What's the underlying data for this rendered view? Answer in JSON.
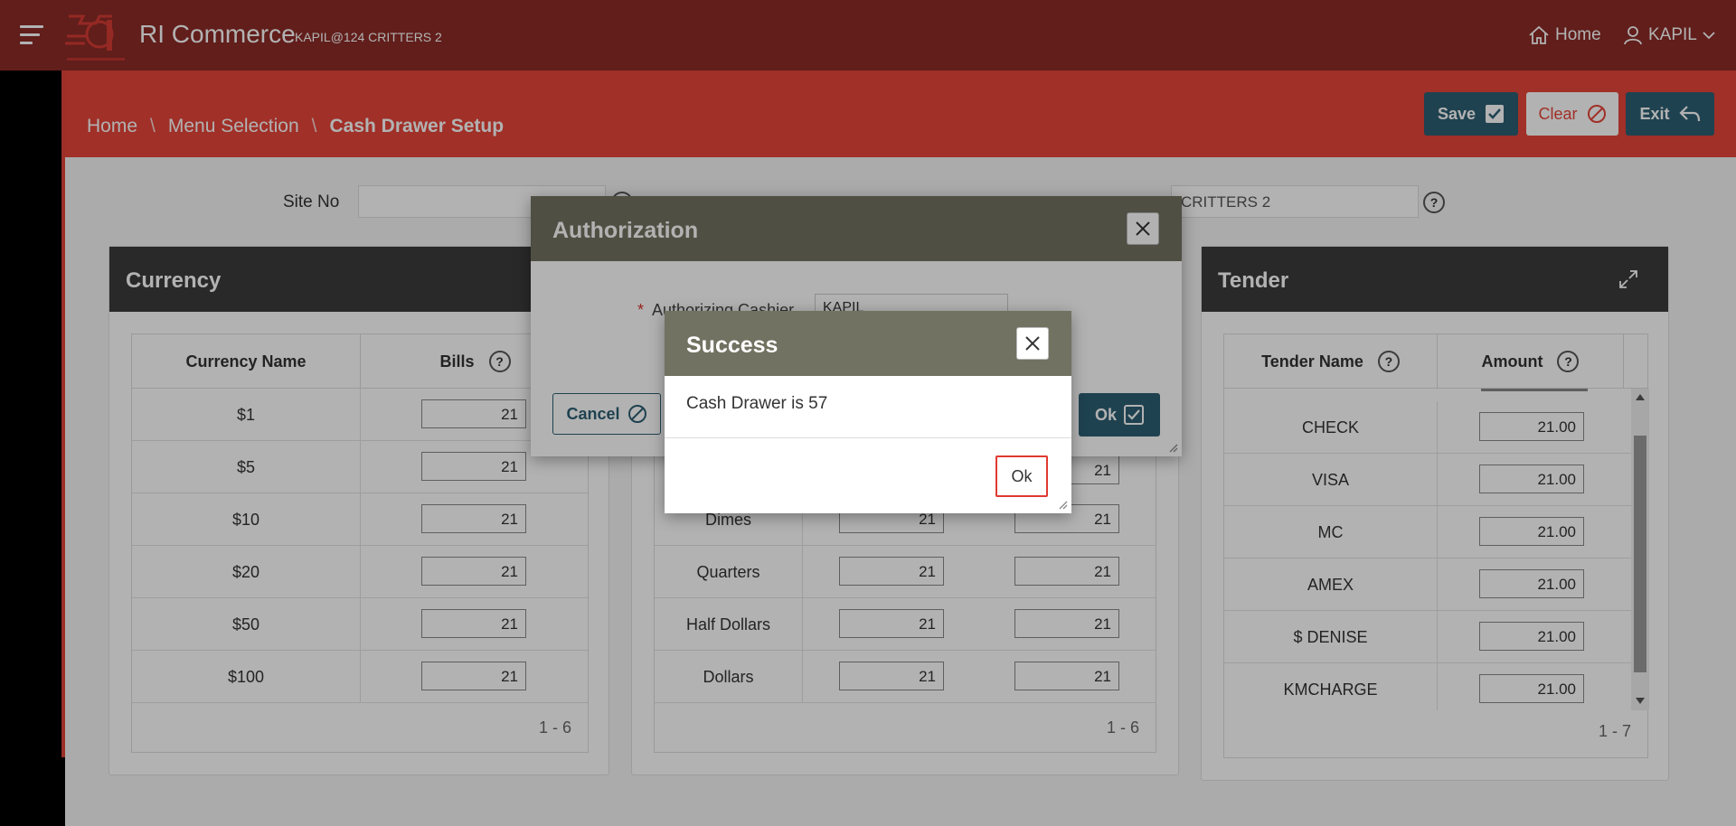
{
  "header": {
    "app_title": "RI Commerce",
    "app_subtitle": "KAPIL@124 CRITTERS 2",
    "home_label": "Home",
    "user_label": "KAPIL"
  },
  "breadcrumb": {
    "home": "Home",
    "menu": "Menu Selection",
    "current": "Cash Drawer Setup"
  },
  "toolbar": {
    "save_label": "Save",
    "clear_label": "Clear",
    "exit_label": "Exit"
  },
  "site": {
    "label": "Site No",
    "site_value": "",
    "location_value": "CRITTERS 2"
  },
  "currency_panel": {
    "title": "Currency",
    "col_name": "Currency Name",
    "col_bills": "Bills",
    "rows": [
      {
        "name": "$1",
        "bills": "21"
      },
      {
        "name": "$5",
        "bills": "21"
      },
      {
        "name": "$10",
        "bills": "21"
      },
      {
        "name": "$20",
        "bills": "21"
      },
      {
        "name": "$50",
        "bills": "21"
      },
      {
        "name": "$100",
        "bills": "21"
      }
    ],
    "pager": "1 - 6"
  },
  "coin_panel": {
    "rows": [
      {
        "name": "Dimes",
        "a": "21",
        "b": "21"
      },
      {
        "name": "Quarters",
        "a": "21",
        "b": "21"
      },
      {
        "name": "Half Dollars",
        "a": "21",
        "b": "21"
      },
      {
        "name": "Dollars",
        "a": "21",
        "b": "21"
      }
    ],
    "hidden_row_b": "21",
    "pager": "1 - 6"
  },
  "tender_panel": {
    "title": "Tender",
    "col_name": "Tender Name",
    "col_amount": "Amount",
    "rows": [
      {
        "name": "CHECK",
        "amount": "21.00"
      },
      {
        "name": "VISA",
        "amount": "21.00"
      },
      {
        "name": "MC",
        "amount": "21.00"
      },
      {
        "name": "AMEX",
        "amount": "21.00"
      },
      {
        "name": "$ DENISE",
        "amount": "21.00"
      },
      {
        "name": "KMCHARGE",
        "amount": "21.00"
      }
    ],
    "pager": "1 - 7"
  },
  "auth_dialog": {
    "title": "Authorization",
    "required_mark": "*",
    "cashier_label": "Authorizing Cashier",
    "cashier_value": "KAPIL",
    "cancel_label": "Cancel",
    "ok_label": "Ok"
  },
  "success_dialog": {
    "title": "Success",
    "message": "Cash Drawer is 57",
    "ok_label": "Ok"
  },
  "colors": {
    "header": "#8c2b28",
    "breadcrumb_bar": "#e6453a",
    "primary_button": "#2d5f73",
    "dialog_header": "#717261",
    "panel_header": "#3b3b3b"
  }
}
